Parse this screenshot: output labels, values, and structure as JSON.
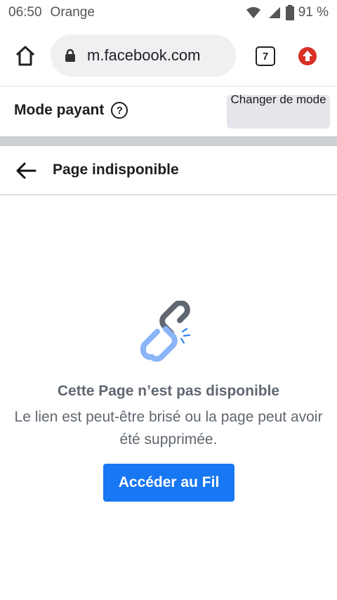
{
  "status_bar": {
    "time": "06:50",
    "carrier": "Orange",
    "battery": "91 %"
  },
  "browser": {
    "url": "m.facebook.com",
    "tab_count": "7"
  },
  "mode": {
    "title": "Mode payant",
    "help_symbol": "?",
    "change_button": "Changer de mode"
  },
  "page_header": {
    "title": "Page indisponible"
  },
  "error": {
    "title": "Cette Page n’est pas disponible",
    "body": "Le lien est peut-être brisé ou la page peut avoir été supprimée.",
    "button": "Accéder au Fil"
  },
  "colors": {
    "accent": "#1877f2",
    "update_badge": "#d93025",
    "link_blue": "#8ab4f8",
    "link_grey": "#606770"
  }
}
